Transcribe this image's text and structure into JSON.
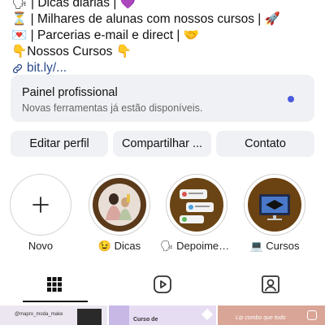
{
  "bio": {
    "lines": [
      "🗣 | Dicas diárias | 💜",
      "⏳ | Milhares de alunas com nossos cursos | 🚀",
      "💌 | Parcerias e-mail e direct | 🤝",
      "👇Nossos Cursos 👇"
    ],
    "link": "bit.ly/..."
  },
  "professional_panel": {
    "title": "Painel profissional",
    "subtitle": "Novas ferramentas já estão disponíveis.",
    "dot_color": "#4a5bdc"
  },
  "buttons": {
    "edit": "Editar perfil",
    "share": "Compartilhar ...",
    "contact": "Contato"
  },
  "highlights": [
    {
      "label": "Novo",
      "icon": "plus-icon"
    },
    {
      "label": "😉 Dicas"
    },
    {
      "label": "🗣 Depoiment..."
    },
    {
      "label": "💻 Cursos"
    }
  ],
  "tabs": {
    "grid": "grid-icon",
    "reels": "reels-icon",
    "tagged": "tagged-icon"
  },
  "posts": [
    {
      "label": "@mapro_moda_make"
    },
    {
      "label": "Curso de"
    },
    {
      "label": "Lip combo que todo"
    }
  ]
}
